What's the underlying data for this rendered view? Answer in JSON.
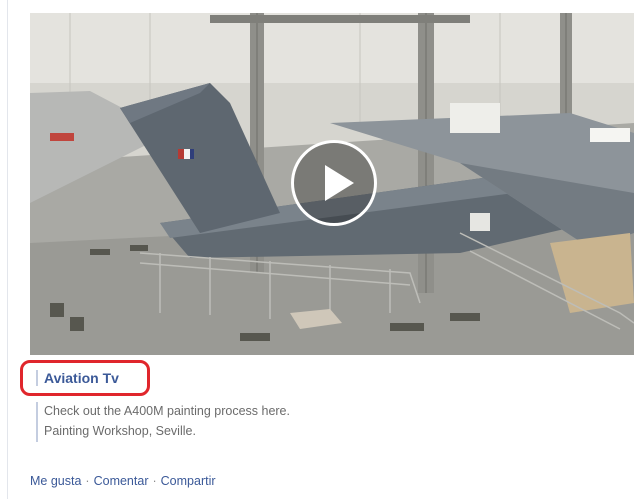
{
  "video": {
    "description": "Video thumbnail",
    "play_icon": "play-icon"
  },
  "attachment": {
    "source_title": "Aviation Tv",
    "description_line_1": "Check out the A400M painting process here.",
    "description_line_2": "Painting Workshop, Seville."
  },
  "actions": {
    "like": "Me gusta",
    "comment": "Comentar",
    "share": "Compartir",
    "separator": "·"
  },
  "colors": {
    "link": "#3b5998",
    "highlight": "#e0262c",
    "muted_text": "#6b6b6b"
  }
}
